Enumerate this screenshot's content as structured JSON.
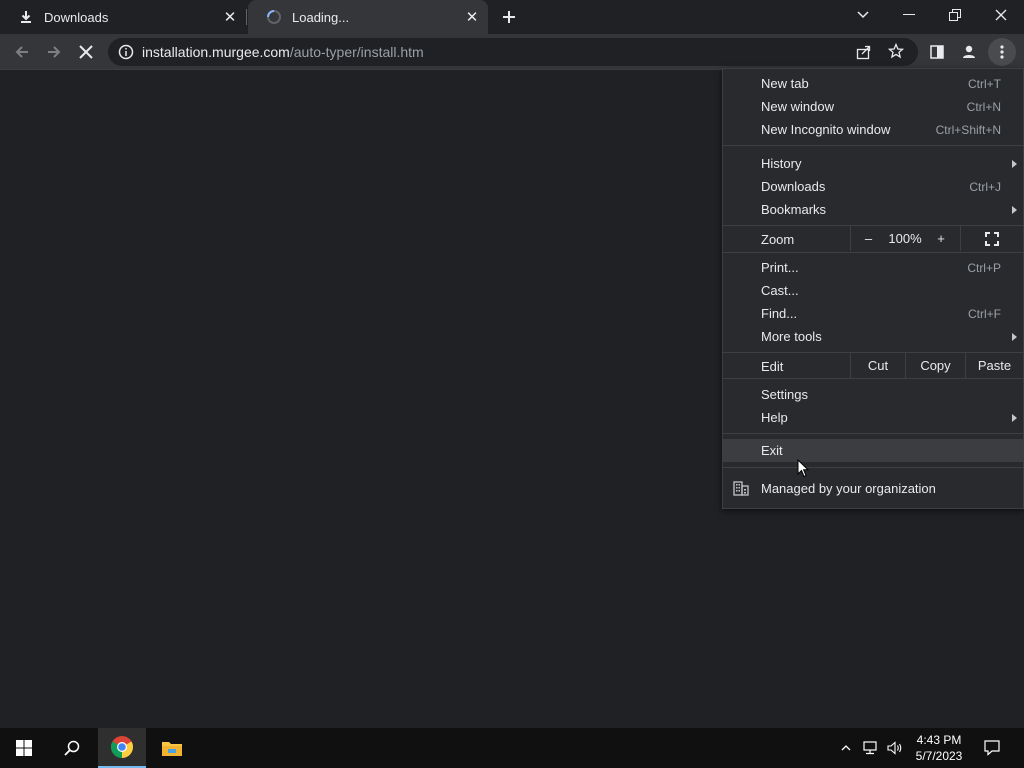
{
  "tabs": [
    {
      "title": "Downloads",
      "icon": "download-icon"
    },
    {
      "title": "Loading...",
      "icon": "spinner-icon"
    }
  ],
  "window_controls": [
    "tab-search",
    "minimize",
    "restore",
    "close"
  ],
  "address_bar": {
    "host": "installation.murgee.com",
    "path": "/auto-typer/install.htm"
  },
  "menu": {
    "new_tab": {
      "label": "New tab",
      "shortcut": "Ctrl+T"
    },
    "new_window": {
      "label": "New window",
      "shortcut": "Ctrl+N"
    },
    "new_incognito": {
      "label": "New Incognito window",
      "shortcut": "Ctrl+Shift+N"
    },
    "history": {
      "label": "History"
    },
    "downloads": {
      "label": "Downloads",
      "shortcut": "Ctrl+J"
    },
    "bookmarks": {
      "label": "Bookmarks"
    },
    "zoom": {
      "label": "Zoom",
      "minus": "–",
      "value": "100%",
      "plus": "+"
    },
    "print": {
      "label": "Print...",
      "shortcut": "Ctrl+P"
    },
    "cast": {
      "label": "Cast..."
    },
    "find": {
      "label": "Find...",
      "shortcut": "Ctrl+F"
    },
    "more_tools": {
      "label": "More tools"
    },
    "edit": {
      "label": "Edit",
      "cut": "Cut",
      "copy": "Copy",
      "paste": "Paste"
    },
    "settings": {
      "label": "Settings"
    },
    "help": {
      "label": "Help"
    },
    "exit": {
      "label": "Exit"
    },
    "managed": {
      "label": "Managed by your organization"
    }
  },
  "taskbar": {
    "time": "4:43 PM",
    "date": "5/7/2023"
  },
  "colors": {
    "background": "#202124",
    "toolbar": "#35363a",
    "menu": "#292a2d",
    "menu_hover": "#3c3d40",
    "taskbar": "#101010"
  }
}
